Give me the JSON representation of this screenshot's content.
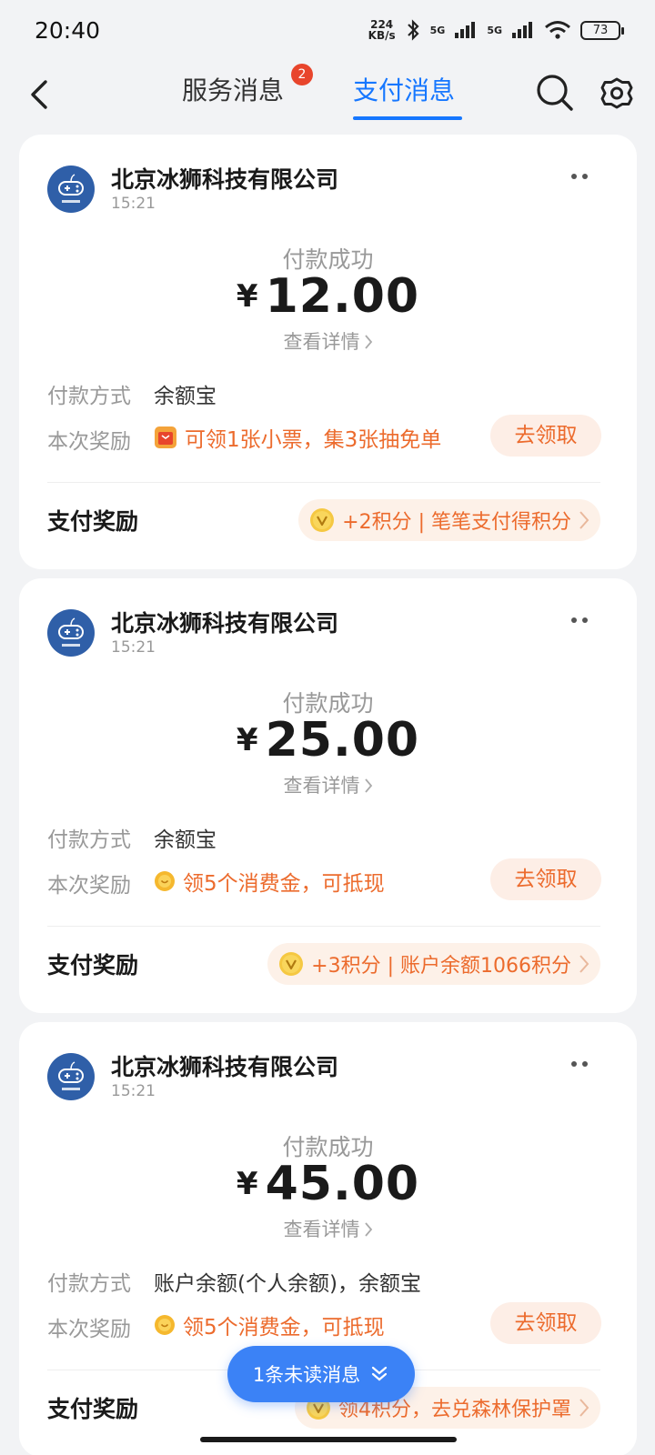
{
  "status_bar": {
    "time": "20:40",
    "net_speed_value": "224",
    "net_speed_unit": "KB/s",
    "signal_1": "5G",
    "signal_2": "5G",
    "battery": "73"
  },
  "nav": {
    "tab_service": "服务消息",
    "tab_service_badge": "2",
    "tab_pay": "支付消息",
    "active_tab": "支付消息"
  },
  "cards": [
    {
      "merchant": "北京冰狮科技有限公司",
      "time": "15:21",
      "status": "付款成功",
      "currency": "¥",
      "amount": "12.00",
      "detail_link": "查看详情",
      "payment_method_label": "付款方式",
      "payment_method": "余额宝",
      "reward_label": "本次奖励",
      "reward_icon": "ticket-icon",
      "reward_text": "可领1张小票，集3张抽免单",
      "claim_label": "去领取",
      "bonus_label": "支付奖励",
      "bonus_text": "+2积分 | 笔笔支付得积分"
    },
    {
      "merchant": "北京冰狮科技有限公司",
      "time": "15:21",
      "status": "付款成功",
      "currency": "¥",
      "amount": "25.00",
      "detail_link": "查看详情",
      "payment_method_label": "付款方式",
      "payment_method": "余额宝",
      "reward_label": "本次奖励",
      "reward_icon": "coin-icon",
      "reward_text": "领5个消费金，可抵现",
      "claim_label": "去领取",
      "bonus_label": "支付奖励",
      "bonus_text": "+3积分 | 账户余额1066积分"
    },
    {
      "merchant": "北京冰狮科技有限公司",
      "time": "15:21",
      "status": "付款成功",
      "currency": "¥",
      "amount": "45.00",
      "detail_link": "查看详情",
      "payment_method_label": "付款方式",
      "payment_method": "账户余额(个人余额)，余额宝",
      "reward_label": "本次奖励",
      "reward_icon": "coin-icon",
      "reward_text": "领5个消费金，可抵现",
      "claim_label": "去领取",
      "bonus_label": "支付奖励",
      "bonus_text": "领4积分，去兑森林保护罩"
    }
  ],
  "unread_button": "1条未读消息",
  "colors": {
    "accent_blue": "#1677ff",
    "reward_orange": "#ec6b2d",
    "badge_red": "#e8452c",
    "background": "#f2f3f5"
  }
}
